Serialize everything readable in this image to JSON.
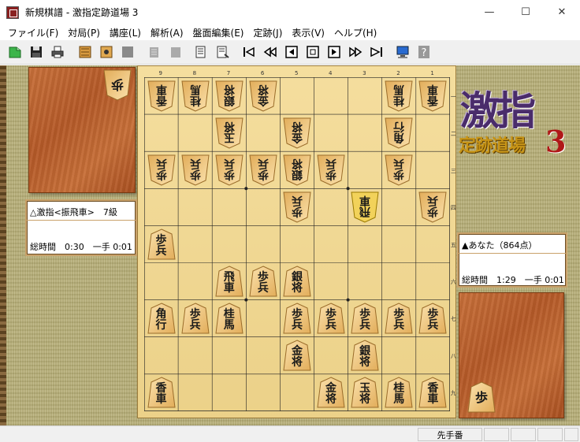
{
  "window": {
    "title": "新規棋譜 - 激指定跡道場 3",
    "app_icon": "app-icon",
    "buttons": {
      "minimize": "—",
      "maximize": "☐",
      "close": "✕"
    }
  },
  "menu": [
    "ファイル(F)",
    "対局(P)",
    "講座(L)",
    "解析(A)",
    "盤面編集(E)",
    "定跡(J)",
    "表示(V)",
    "ヘルプ(H)"
  ],
  "toolbar": {
    "icons": [
      "new-file-icon",
      "save-icon",
      "print-icon",
      "edit-kifu-icon",
      "edit-board-icon",
      "disabled-icon",
      "copy-disabled-icon",
      "paste-disabled-icon",
      "board-export-icon",
      "board-import-icon",
      "first-move-icon",
      "back-ten-icon",
      "back-one-icon",
      "stop-icon",
      "forward-one-icon",
      "forward-ten-icon",
      "last-move-icon",
      "monitor-icon",
      "help-icon"
    ]
  },
  "logo": {
    "main": "激指",
    "sub": "定跡道場",
    "num": "3"
  },
  "gote": {
    "name": "△激指<振飛車>　7級",
    "time": "総時間　0:30　一手 0:01",
    "hand": [
      "歩"
    ]
  },
  "sente": {
    "name": "▲あなた（864点）",
    "time": "総時間　1:29　一手 0:01",
    "hand": [
      "歩"
    ]
  },
  "board": {
    "files": [
      "9",
      "8",
      "7",
      "6",
      "5",
      "4",
      "3",
      "2",
      "1"
    ],
    "ranks": [
      "一",
      "二",
      "三",
      "四",
      "五",
      "六",
      "七",
      "八",
      "九"
    ],
    "pieces": [
      {
        "f": 9,
        "r": 1,
        "t": "香車",
        "o": "g"
      },
      {
        "f": 8,
        "r": 1,
        "t": "桂馬",
        "o": "g"
      },
      {
        "f": 7,
        "r": 1,
        "t": "銀将",
        "o": "g"
      },
      {
        "f": 6,
        "r": 1,
        "t": "金将",
        "o": "g"
      },
      {
        "f": 2,
        "r": 1,
        "t": "桂馬",
        "o": "g"
      },
      {
        "f": 1,
        "r": 1,
        "t": "香車",
        "o": "g"
      },
      {
        "f": 7,
        "r": 2,
        "t": "玉将",
        "o": "g"
      },
      {
        "f": 5,
        "r": 2,
        "t": "金将",
        "o": "g"
      },
      {
        "f": 2,
        "r": 2,
        "t": "角行",
        "o": "g"
      },
      {
        "f": 9,
        "r": 3,
        "t": "歩兵",
        "o": "g"
      },
      {
        "f": 8,
        "r": 3,
        "t": "歩兵",
        "o": "g"
      },
      {
        "f": 7,
        "r": 3,
        "t": "歩兵",
        "o": "g"
      },
      {
        "f": 6,
        "r": 3,
        "t": "歩兵",
        "o": "g"
      },
      {
        "f": 5,
        "r": 3,
        "t": "銀将",
        "o": "g"
      },
      {
        "f": 4,
        "r": 3,
        "t": "歩兵",
        "o": "g"
      },
      {
        "f": 2,
        "r": 3,
        "t": "歩兵",
        "o": "g"
      },
      {
        "f": 5,
        "r": 4,
        "t": "歩兵",
        "o": "g"
      },
      {
        "f": 3,
        "r": 4,
        "t": "飛車",
        "o": "g",
        "last": true
      },
      {
        "f": 1,
        "r": 4,
        "t": "歩兵",
        "o": "g"
      },
      {
        "f": 9,
        "r": 5,
        "t": "歩兵",
        "o": "s"
      },
      {
        "f": 7,
        "r": 6,
        "t": "飛車",
        "o": "s"
      },
      {
        "f": 6,
        "r": 6,
        "t": "歩兵",
        "o": "s"
      },
      {
        "f": 5,
        "r": 6,
        "t": "銀将",
        "o": "s"
      },
      {
        "f": 9,
        "r": 7,
        "t": "角行",
        "o": "s"
      },
      {
        "f": 8,
        "r": 7,
        "t": "歩兵",
        "o": "s"
      },
      {
        "f": 7,
        "r": 7,
        "t": "桂馬",
        "o": "s"
      },
      {
        "f": 5,
        "r": 7,
        "t": "歩兵",
        "o": "s"
      },
      {
        "f": 4,
        "r": 7,
        "t": "歩兵",
        "o": "s"
      },
      {
        "f": 3,
        "r": 7,
        "t": "歩兵",
        "o": "s"
      },
      {
        "f": 2,
        "r": 7,
        "t": "歩兵",
        "o": "s"
      },
      {
        "f": 1,
        "r": 7,
        "t": "歩兵",
        "o": "s"
      },
      {
        "f": 5,
        "r": 8,
        "t": "金将",
        "o": "s"
      },
      {
        "f": 3,
        "r": 8,
        "t": "銀将",
        "o": "s"
      },
      {
        "f": 9,
        "r": 9,
        "t": "香車",
        "o": "s"
      },
      {
        "f": 4,
        "r": 9,
        "t": "金将",
        "o": "s"
      },
      {
        "f": 3,
        "r": 9,
        "t": "玉将",
        "o": "s"
      },
      {
        "f": 2,
        "r": 9,
        "t": "桂馬",
        "o": "s"
      },
      {
        "f": 1,
        "r": 9,
        "t": "香車",
        "o": "s"
      }
    ]
  },
  "status": {
    "turn": "先手番",
    "cells": [
      "",
      "",
      "",
      ""
    ]
  }
}
